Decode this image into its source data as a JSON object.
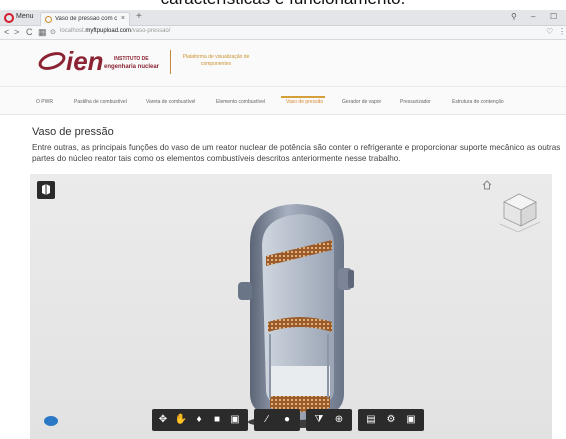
{
  "caption": {
    "text": "características e funcionamento."
  },
  "browser": {
    "menu_label": "Menu",
    "tab_title": "Vaso de pressão com com",
    "tab_close": "×",
    "new_tab": "+",
    "url_prefix": "localhost.",
    "url_domain": "myftpupload.com",
    "url_path": "/vaso-pressao/",
    "nav_back": "<",
    "nav_forward": ">",
    "nav_reload": "C",
    "nav_grid": "▦",
    "nav_site_info": "⊙",
    "win_filter": "⚲",
    "win_min": "–",
    "win_max": "☐",
    "shield": "♡",
    "menu_dots": "⋮"
  },
  "header": {
    "logo_text": "ien",
    "logo_sub1": "INSTITUTO DE",
    "logo_sub2": "engenharia nuclear",
    "platform_title": "Plataforma de visualização de componentes"
  },
  "nav": {
    "items": [
      {
        "label": "O PWR",
        "active": false
      },
      {
        "label": "Pastilha de combustível",
        "active": false
      },
      {
        "label": "Vareta de combustível",
        "active": false
      },
      {
        "label": "Elemento combustível",
        "active": false
      },
      {
        "label": "Vaso de pressão",
        "active": true
      },
      {
        "label": "Gerador de vapor",
        "active": false
      },
      {
        "label": "Pressurizador",
        "active": false
      },
      {
        "label": "Estrutura de contenção",
        "active": false
      }
    ]
  },
  "content": {
    "title": "Vaso de pressão",
    "description": "Entre outras, as principais funções do vaso de um reator nuclear de potência são conter o refrigerante e proporcionar suporte mecânico as outras partes do núcleo reator tais como os elementos combustíveis descritos anteriormente nesse trabalho."
  },
  "viewer": {
    "icons": [
      "model-browser-icon",
      "home-icon",
      "viewcube",
      "globe-icon"
    ],
    "toolbar": {
      "groups": [
        [
          "orbit-icon",
          "pan-icon",
          "first-person-icon",
          "camera-icon",
          "fit-view-icon"
        ],
        [
          "measure-icon",
          "explode-icon"
        ],
        [
          "section-icon",
          "model-tree-icon"
        ],
        [
          "properties-icon",
          "settings-icon",
          "fullscreen-icon"
        ]
      ]
    }
  },
  "colors": {
    "brand": "#8b2332",
    "accent": "#d48a33",
    "toolbar": "#2b2b2b",
    "vessel": "#8a94a6",
    "core": "#a0602e"
  }
}
